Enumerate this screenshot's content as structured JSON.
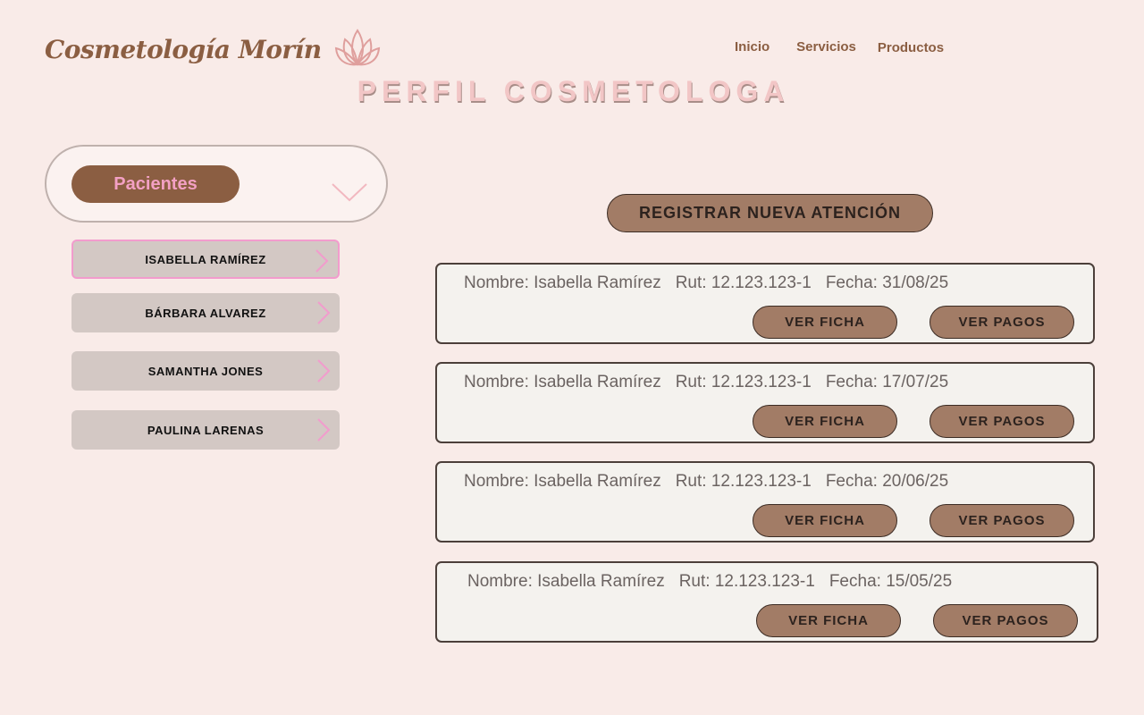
{
  "header": {
    "brand": "Cosmetología Morín",
    "logo_icon": "lotus-icon",
    "nav": [
      "Inicio",
      "Servicios",
      "Productos"
    ]
  },
  "page_title": "PERFIL COSMETOLOGA",
  "sidebar": {
    "pacientes_label": "Pacientes",
    "patients": [
      {
        "name": "ISABELLA RAMÍREZ",
        "selected": true
      },
      {
        "name": "BÁRBARA ALVAREZ",
        "selected": false
      },
      {
        "name": "SAMANTHA JONES",
        "selected": false
      },
      {
        "name": "PAULINA LARENAS",
        "selected": false
      }
    ]
  },
  "main": {
    "register_label": "REGISTRAR NUEVA ATENCIÓN",
    "records": [
      {
        "nombre": "Nombre: Isabella Ramírez",
        "rut": "Rut: 12.123.123-1",
        "fecha": "Fecha: 31/08/25",
        "ficha_label": "VER FICHA",
        "pagos_label": "VER PAGOS"
      },
      {
        "nombre": "Nombre: Isabella Ramírez",
        "rut": "Rut: 12.123.123-1",
        "fecha": "Fecha: 17/07/25",
        "ficha_label": "VER FICHA",
        "pagos_label": "VER PAGOS"
      },
      {
        "nombre": "Nombre: Isabella Ramírez",
        "rut": "Rut: 12.123.123-1",
        "fecha": "Fecha: 20/06/25",
        "ficha_label": "VER FICHA",
        "pagos_label": "VER PAGOS"
      },
      {
        "nombre": "Nombre: Isabella Ramírez",
        "rut": "Rut: 12.123.123-1",
        "fecha": "Fecha: 15/05/25",
        "ficha_label": "VER FICHA",
        "pagos_label": "VER PAGOS"
      }
    ]
  },
  "colors": {
    "background": "#f9ebe8",
    "brand_brown": "#8b5e42",
    "accent_pink": "#f29ccd",
    "button_brown": "#a27c66"
  }
}
